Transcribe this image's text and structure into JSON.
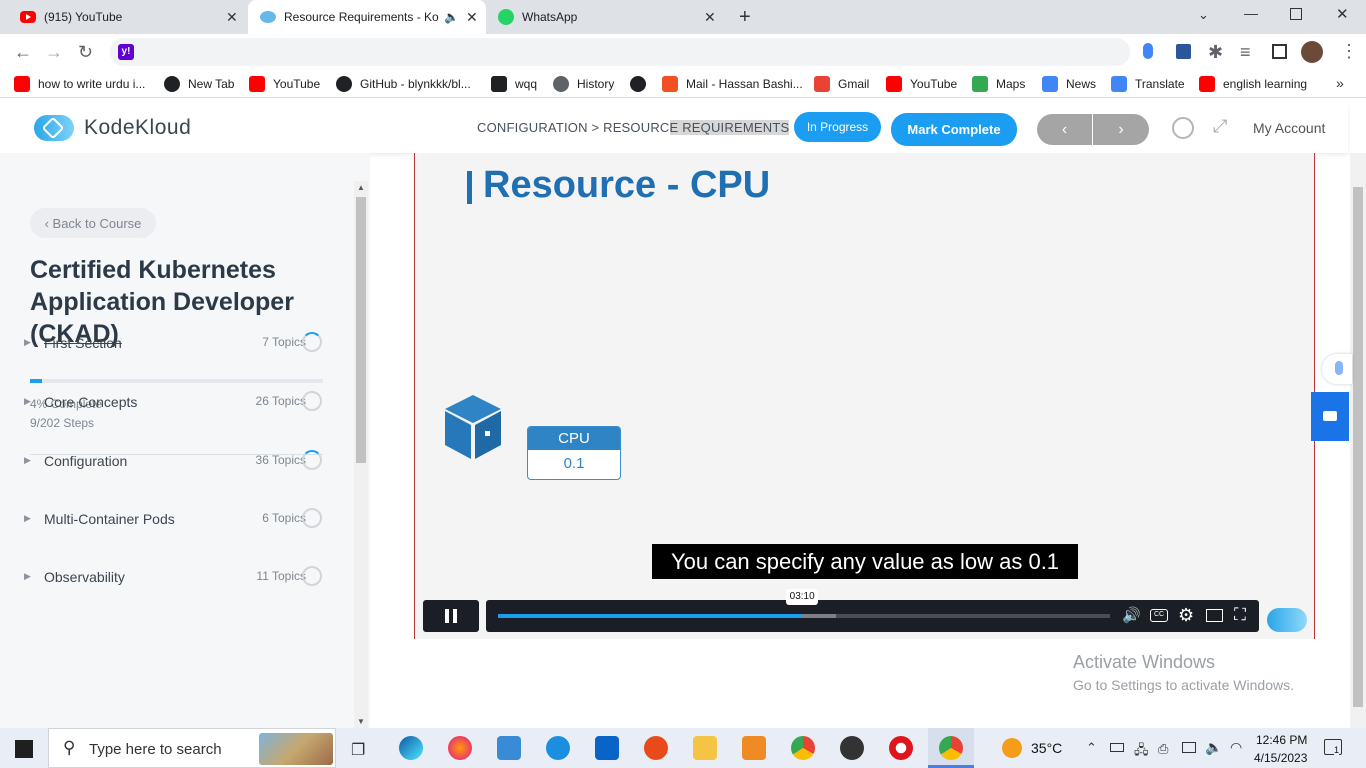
{
  "tabs": [
    {
      "title": "(915) YouTube",
      "icon": "youtube-icon"
    },
    {
      "title": "Resource Requirements - Ko",
      "icon": "kodekloud-icon",
      "active": true
    },
    {
      "title": "WhatsApp",
      "icon": "whatsapp-icon"
    }
  ],
  "omnibox": {
    "value": ""
  },
  "bookmarks": [
    {
      "label": "how to write urdu i...",
      "icon": "youtube-icon",
      "color": "#ff0000"
    },
    {
      "label": "New Tab",
      "icon": "globe-icon",
      "color": "#202124"
    },
    {
      "label": "YouTube",
      "icon": "youtube-icon",
      "color": "#ff0000"
    },
    {
      "label": "GitHub - blynkkk/bl...",
      "icon": "github-icon",
      "color": "#202124"
    },
    {
      "label": "wqq",
      "icon": "download-icon",
      "color": "#202124"
    },
    {
      "label": "History",
      "icon": "history-icon",
      "color": "#5f6368"
    },
    {
      "label": "",
      "icon": "globe-icon",
      "color": "#202124"
    },
    {
      "label": "Mail - Hassan Bashi...",
      "icon": "microsoft-icon",
      "color": "#f25022"
    },
    {
      "label": "Gmail",
      "icon": "gmail-icon",
      "color": "#ea4335"
    },
    {
      "label": "YouTube",
      "icon": "youtube-icon",
      "color": "#ff0000"
    },
    {
      "label": "Maps",
      "icon": "maps-icon",
      "color": "#34a853"
    },
    {
      "label": "News",
      "icon": "news-icon",
      "color": "#4285f4"
    },
    {
      "label": "Translate",
      "icon": "translate-icon",
      "color": "#4285f4"
    },
    {
      "label": "english learning",
      "icon": "youtube-icon",
      "color": "#ff0000"
    }
  ],
  "header": {
    "logo": "KodeKloud",
    "breadcrumb_a": "CONFIGURATION > RESOURC",
    "breadcrumb_b": "E REQUIREMENTS",
    "status": "In Progress",
    "mark_complete": "Mark Complete",
    "prev": "‹",
    "next": "›",
    "account": "My Account",
    "accent": "#1b9df2"
  },
  "sidebar": {
    "back": "‹  Back to Course",
    "course_title": "Certified Kubernetes Application Developer (CKAD)",
    "progress_percent": 4,
    "complete_text": "4% Complete",
    "steps_text": "9/202 Steps",
    "sections": [
      {
        "name": "First Section",
        "topics": "7 Topics",
        "struck": true
      },
      {
        "name": "Core Concepts",
        "topics": "26 Topics"
      },
      {
        "name": "Configuration",
        "topics": "36 Topics"
      },
      {
        "name": "Multi-Container Pods",
        "topics": "6 Topics"
      },
      {
        "name": "Observability",
        "topics": "11 Topics"
      }
    ]
  },
  "video": {
    "slide_title": "Resource - CPU",
    "cpu_label": "CPU",
    "cpu_value": "0.1",
    "subtitle": "You can specify any value as low as 0.1",
    "time": "03:10",
    "played_fraction": 0.497,
    "buffered_fraction": 0.552
  },
  "watermark": {
    "line1": "Activate Windows",
    "line2": "Go to Settings to activate Windows."
  },
  "taskbar": {
    "search_placeholder": "Type here to search",
    "weather": "35°C",
    "time": "12:46 PM",
    "date": "4/15/2023",
    "notifications": "1"
  }
}
